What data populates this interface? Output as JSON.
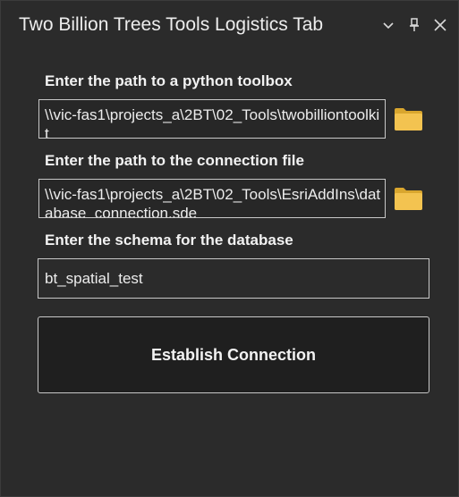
{
  "window": {
    "title": "Two Billion Trees Tools Logistics Tab",
    "controls": {
      "options_icon": "chevron-down-icon",
      "pin_icon": "pin-icon",
      "close_icon": "close-icon"
    }
  },
  "form": {
    "toolbox": {
      "label": "Enter the path to a python toolbox",
      "value": "\\\\vic-fas1\\projects_a\\2BT\\02_Tools\\twobilliontoolkit",
      "browse_icon": "folder-icon"
    },
    "connection": {
      "label": "Enter the path to the connection file",
      "value": "\\\\vic-fas1\\projects_a\\2BT\\02_Tools\\EsriAddIns\\database_connection.sde",
      "browse_icon": "folder-icon"
    },
    "schema": {
      "label": "Enter the schema for the database",
      "value": "bt_spatial_test"
    },
    "establish_button": {
      "label": "Establish Connection"
    }
  },
  "colors": {
    "background": "#2b2b2b",
    "text": "#f2f2f2",
    "border": "#c8c8c8",
    "button_bg": "#1f1f1f",
    "folder_yellow": "#f3c350"
  }
}
